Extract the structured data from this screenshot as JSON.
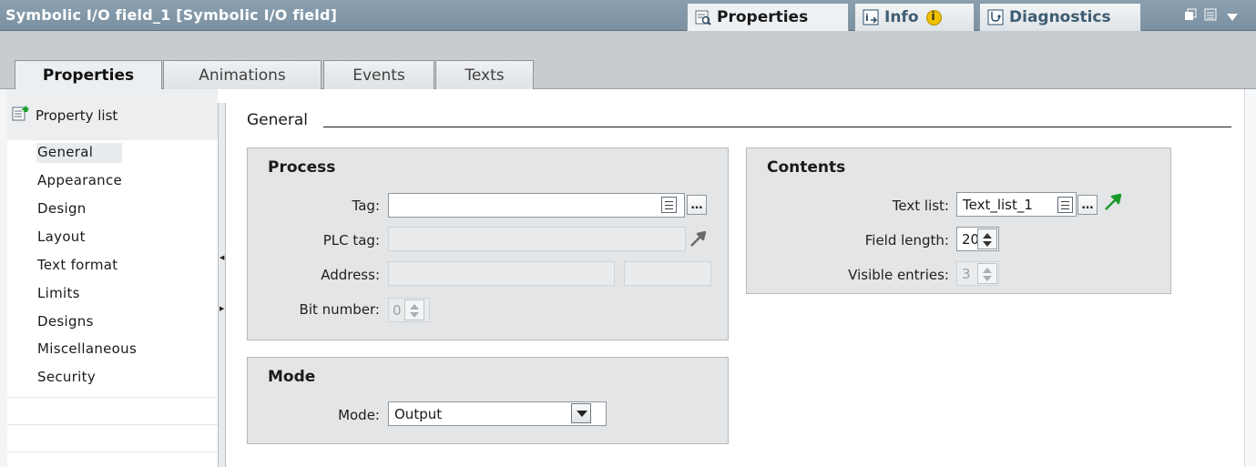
{
  "header": {
    "title": "Symbolic I/O field_1 [Symbolic I/O field]",
    "tabs": [
      {
        "label": "Properties",
        "icon": "properties-icon",
        "active": true
      },
      {
        "label": "Info",
        "icon": "info-icon",
        "badge": "i",
        "active": false
      },
      {
        "label": "Diagnostics",
        "icon": "diagnostics-icon",
        "active": false
      }
    ],
    "window_controls": [
      "restore-icon",
      "menu-icon",
      "dropdown-icon"
    ]
  },
  "tabs": [
    {
      "label": "Properties",
      "active": true
    },
    {
      "label": "Animations",
      "active": false
    },
    {
      "label": "Events",
      "active": false
    },
    {
      "label": "Texts",
      "active": false
    }
  ],
  "nav": {
    "header_label": "Property list",
    "items": [
      "General",
      "Appearance",
      "Design",
      "Layout",
      "Text format",
      "Limits",
      "Designs",
      "Miscellaneous",
      "Security"
    ],
    "selected": "General"
  },
  "content": {
    "section_title": "General",
    "process": {
      "title": "Process",
      "tag_label": "Tag:",
      "tag_value": "",
      "plc_tag_label": "PLC tag:",
      "plc_tag_value": "",
      "address_label": "Address:",
      "address_value": "",
      "address_extra": "",
      "bit_number_label": "Bit number:",
      "bit_number_value": "0"
    },
    "mode": {
      "title": "Mode",
      "mode_label": "Mode:",
      "mode_value": "Output"
    },
    "contents": {
      "title": "Contents",
      "text_list_label": "Text list:",
      "text_list_value": "Text_list_1",
      "field_length_label": "Field length:",
      "field_length_value": "20",
      "visible_entries_label": "Visible entries:",
      "visible_entries_value": "3"
    }
  },
  "colors": {
    "titlebar": "#7b91a1",
    "group_bg": "#e3e5e7",
    "goto_arrow_green": "#1a9a2a",
    "goto_arrow_gray": "#6a6a6a"
  }
}
